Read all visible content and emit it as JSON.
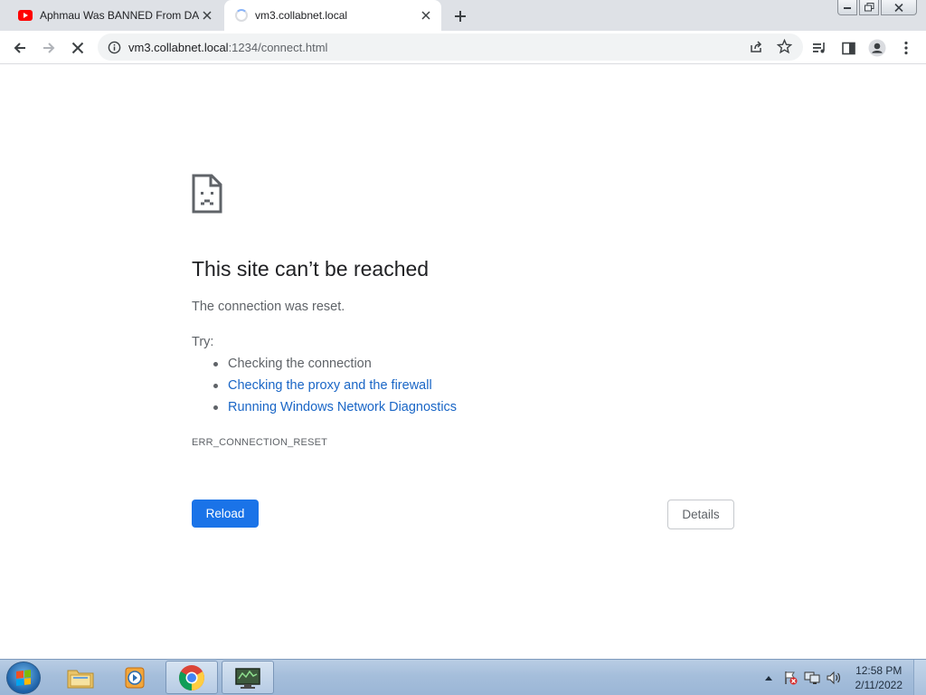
{
  "browser": {
    "tabs": [
      {
        "title": "Aphmau Was BANNED From DAYCARE",
        "favicon": "youtube-icon",
        "active": false
      },
      {
        "title": "vm3.collabnet.local",
        "favicon": "loading-spinner",
        "active": true
      }
    ],
    "address": {
      "host": "vm3.collabnet.local",
      "path": ":1234/connect.html"
    }
  },
  "error_page": {
    "title": "This site can’t be reached",
    "description": "The connection was reset.",
    "try_label": "Try:",
    "suggestions": [
      {
        "text": "Checking the connection",
        "is_link": false
      },
      {
        "text": "Checking the proxy and the firewall",
        "is_link": true
      },
      {
        "text": "Running Windows Network Diagnostics",
        "is_link": true
      }
    ],
    "error_code": "ERR_CONNECTION_RESET",
    "reload_label": "Reload",
    "details_label": "Details"
  },
  "taskbar": {
    "clock_time": "12:58 PM",
    "clock_date": "2/11/2022",
    "apps": [
      "windows-explorer",
      "media-player",
      "chrome",
      "remote-desktop"
    ]
  },
  "colors": {
    "accent": "#1a73e8",
    "link": "#1a66c6",
    "text_primary": "#202124",
    "text_secondary": "#5f6368"
  }
}
